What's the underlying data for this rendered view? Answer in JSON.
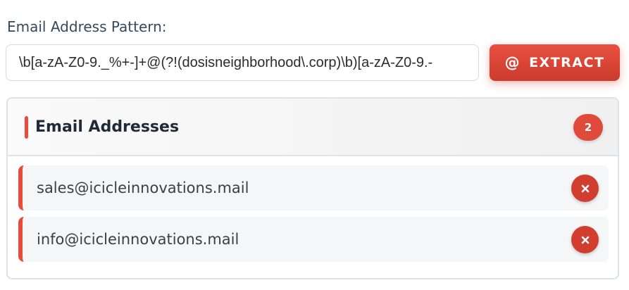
{
  "pattern": {
    "label": "Email Address Pattern:",
    "value": "\\b[a-zA-Z0-9._%+-]+@(?!(dosisneighborhood\\.corp)\\b)[a-zA-Z0-9.-"
  },
  "extract_button": {
    "icon": "@",
    "label": "EXTRACT"
  },
  "results": {
    "title": "Email Addresses",
    "count": "2",
    "items": [
      {
        "email": "sales@icicleinnovations.mail"
      },
      {
        "email": "info@icicleinnovations.mail"
      }
    ]
  },
  "colors": {
    "accent": "#e74c3c",
    "button": "#cc3b2c"
  }
}
